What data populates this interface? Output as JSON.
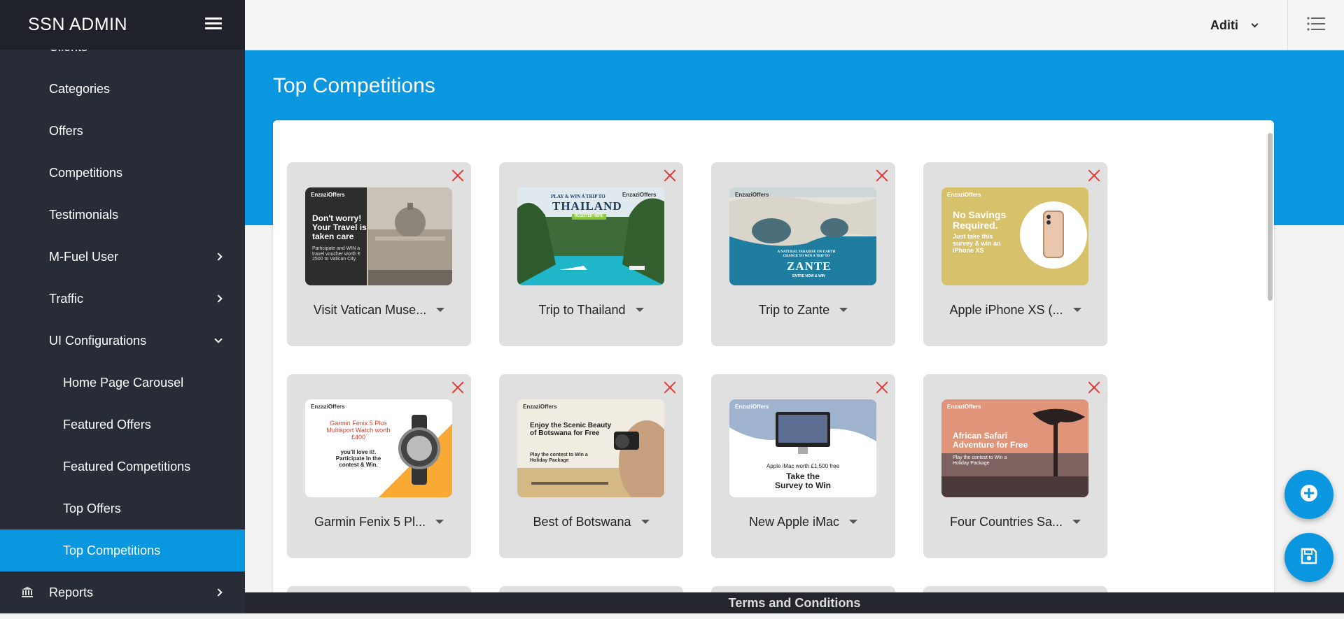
{
  "brand": "SSN ADMIN",
  "sidebar": {
    "items": [
      {
        "label": "Clients"
      },
      {
        "label": "Categories"
      },
      {
        "label": "Offers"
      },
      {
        "label": "Competitions"
      },
      {
        "label": "Testimonials"
      },
      {
        "label": "M-Fuel User"
      },
      {
        "label": "Traffic"
      },
      {
        "label": "UI Configurations"
      },
      {
        "label": "Home Page Carousel"
      },
      {
        "label": "Featured Offers"
      },
      {
        "label": "Featured Competitions"
      },
      {
        "label": "Top Offers"
      },
      {
        "label": "Top Competitions"
      },
      {
        "label": "Reports"
      }
    ]
  },
  "header": {
    "user": "Aditi"
  },
  "page": {
    "title": "Top Competitions"
  },
  "cards": [
    {
      "label": "Visit Vatican Muse...",
      "banner": {
        "brand": "EnzaziOffers",
        "headline": "Don't worry! Your Travel is taken care",
        "body": "Participate and WIN a travel voucher worth € 2500 to Vatican City."
      }
    },
    {
      "label": "Trip to Thailand",
      "banner": {
        "brand": "EnzaziOffers",
        "headline": "PLAY & WIN A TRIP TO",
        "body": "THAILAND",
        "cta": "REGISTER HERE"
      }
    },
    {
      "label": "Trip to Zante",
      "banner": {
        "brand": "EnzaziOffers",
        "headline": "A NATURAL PARADISE ON EARTH CHANCE TO WIN A TRIP TO",
        "body": "ZANTE",
        "cta": "ENTRE NOW & WIN"
      }
    },
    {
      "label": "Apple iPhone XS (...",
      "banner": {
        "brand": "EnzaziOffers",
        "headline": "No Savings Required.",
        "body": "Just take this survey & win an iPhone XS"
      }
    },
    {
      "label": "Garmin Fenix 5 Pl...",
      "banner": {
        "brand": "EnzaziOffers",
        "headline": "Garmin Fenix 5 Plus Multisport Watch worth £400",
        "body": "you'll love it!. Participate in the contest & Win."
      }
    },
    {
      "label": "Best of Botswana",
      "banner": {
        "brand": "EnzaziOffers",
        "headline": "Enjoy the Scenic Beauty of Botswana for Free",
        "body": "Play the contest to Win a Holiday Package"
      }
    },
    {
      "label": "New Apple iMac",
      "banner": {
        "brand": "EnzaziOffers",
        "headline": "Apple iMac worth £1,500 free",
        "body": "Take the Survey to Win"
      }
    },
    {
      "label": "Four Countries Sa...",
      "banner": {
        "brand": "EnzaziOffers",
        "headline": "African Safari Adventure for Free",
        "body": "Play the contest to Win a Holiday Package"
      }
    }
  ],
  "footer": {
    "link": "Terms and Conditions"
  },
  "colors": {
    "accent": "#0b97e0",
    "sidebar_bg": "#282c36",
    "remove": "#e53935"
  },
  "icons": {
    "menu": "hamburger-icon",
    "list": "list-icon",
    "remove": "close-icon",
    "add": "plus-circle-icon",
    "save": "save-icon",
    "reports": "bank-icon"
  }
}
